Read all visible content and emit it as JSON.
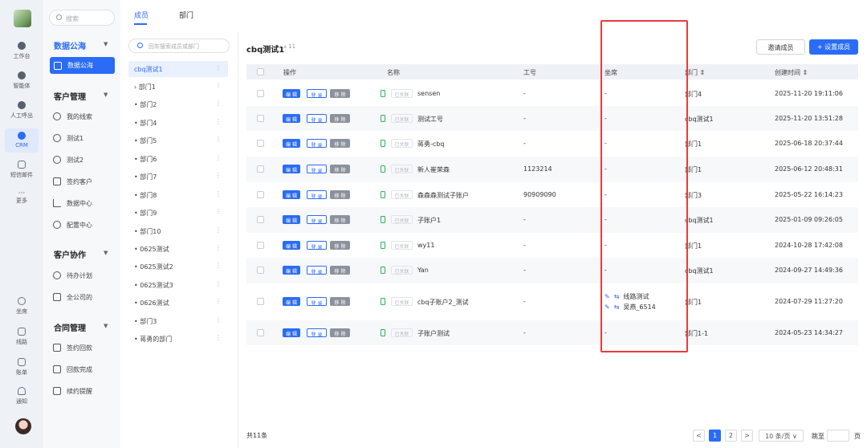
{
  "rail": {
    "items": [
      {
        "label": "工作台",
        "icon": "dashboard-icon"
      },
      {
        "label": "智能体",
        "icon": "agent-icon"
      },
      {
        "label": "人工呼出",
        "icon": "phone-out-icon"
      },
      {
        "label": "CRM",
        "icon": "crm-icon"
      },
      {
        "label": "短信邮件",
        "icon": "message-icon"
      },
      {
        "label": "更多",
        "icon": "more-icon"
      }
    ],
    "bottom_items": [
      {
        "label": "坐席",
        "icon": "headset-icon"
      },
      {
        "label": "线路",
        "icon": "route-icon"
      },
      {
        "label": "账单",
        "icon": "bill-icon"
      },
      {
        "label": "通知",
        "icon": "bell-icon"
      }
    ]
  },
  "sidebar": {
    "search_placeholder": "搜索",
    "groups": [
      {
        "title": "数据公海",
        "items": [
          "数据公海"
        ]
      },
      {
        "title": "客户管理",
        "items": [
          "我的线索",
          "测试1",
          "测试2",
          "签约客户",
          "数据中心",
          "配置中心"
        ]
      },
      {
        "title": "客户协作",
        "items": [
          "待办计划",
          "全公司的"
        ]
      },
      {
        "title": "合同管理",
        "items": [
          "签约回款",
          "回款完成",
          "续约提醒"
        ]
      }
    ]
  },
  "tabs": [
    "成员",
    "部门"
  ],
  "tree": {
    "search_placeholder": "回车搜索成员或部门",
    "nodes": [
      "cbq测试1",
      "› 部门1",
      "• 部门2",
      "• 部门4",
      "• 部门5",
      "• 部门6",
      "• 部门7",
      "• 部门8",
      "• 部门9",
      "• 部门10",
      "• 0625测试",
      "• 0625测试2",
      "• 0625测试3",
      "• 0626测试",
      "• 部门3",
      "• 蒋勇的部门"
    ],
    "more": "⋮"
  },
  "panel": {
    "title": "cbq测试1",
    "count": "⩓ 11",
    "invite_label": "邀请成员",
    "setup_label": "+ 设置成员"
  },
  "table": {
    "headers": [
      "操作",
      "名称",
      "工号",
      "坐席",
      "部门 ⇕",
      "创建时间 ⇕"
    ],
    "actions": {
      "edit": "编 辑",
      "login": "登 录",
      "remove": "移 除"
    },
    "linked_label": "已关联",
    "rows": [
      {
        "name": "sensen",
        "no": "-",
        "seat": "-",
        "dept": "部门4",
        "created": "2025-11-20 19:11:06"
      },
      {
        "name": "测试工号",
        "no": "-",
        "seat": "-",
        "dept": "cbq测试1",
        "created": "2025-11-20 13:51:28"
      },
      {
        "name": "蒋勇-cbq",
        "no": "-",
        "seat": "-",
        "dept": "部门1",
        "created": "2025-06-18 20:37:44"
      },
      {
        "name": "新人崔荣森",
        "no": "1123214",
        "seat": "-",
        "dept": "部门1",
        "created": "2025-06-12 20:48:31"
      },
      {
        "name": "森森森测试子账户",
        "no": "90909090",
        "seat": "-",
        "dept": "部门3",
        "created": "2025-05-22 16:14:23"
      },
      {
        "name": "子账户1",
        "no": "-",
        "seat": "-",
        "dept": "cbq测试1",
        "created": "2025-01-09 09:26:05"
      },
      {
        "name": "wy11",
        "no": "-",
        "seat": "-",
        "dept": "部门1",
        "created": "2024-10-28 17:42:08"
      },
      {
        "name": "Yan",
        "no": "-",
        "seat": "-",
        "dept": "cbq测试1",
        "created": "2024-09-27 14:49:36"
      },
      {
        "name": "cbq子账户2_测试",
        "no": "-",
        "seat_lines": [
          "线路测试",
          "吴燕_6514"
        ],
        "dept": "部门1",
        "created": "2024-07-29 11:27:20"
      },
      {
        "name": "子账户测试",
        "no": "-",
        "seat": "-",
        "dept": "部门1-1",
        "created": "2024-05-23 14:34:27"
      }
    ]
  },
  "footer": {
    "total": "共11条",
    "pages": [
      "1",
      "2"
    ],
    "prev": "<",
    "next": ">",
    "page_size": "10 条/页 ∨",
    "goto_label": "跳至",
    "page_suffix": "页"
  },
  "colors": {
    "accent": "#2b6cf6",
    "highlight": "#ea3a3a"
  }
}
